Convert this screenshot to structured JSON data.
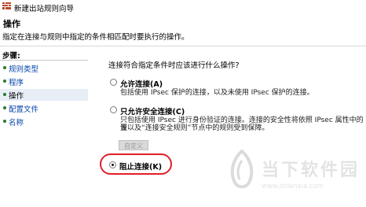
{
  "window": {
    "title": "新建出站规则向导"
  },
  "header": {
    "title": "操作",
    "description": "指定在连接与规则中指定的条件相匹配时要执行的操作。"
  },
  "sidebar": {
    "steps_label": "步骤:",
    "items": [
      {
        "label": "规则类型"
      },
      {
        "label": "程序"
      },
      {
        "label": "操作"
      },
      {
        "label": "配置文件"
      },
      {
        "label": "名称"
      }
    ]
  },
  "main": {
    "question": "连接符合指定条件时应该进行什么操作?",
    "options": [
      {
        "label": "允许连接(A)",
        "desc_lines": [
          "包括使用 IPsec 保护的连接，以及未使用 IPsec 保护的连接。"
        ]
      },
      {
        "label": "只允许安全连接(C)",
        "desc_lines": [
          "只包括使用 IPsec 进行身份验证的连接。连接的安全性将依照 IPsec 属性中的设",
          "置以及“连接安全规则”节点中的规则受到保障。"
        ]
      },
      {
        "label": "阻止连接(K)",
        "desc_lines": []
      }
    ],
    "customize_label": "自定义",
    "selected_option": 2
  },
  "watermark": {
    "text": "当下软件园",
    "url": "www.downxia.com"
  },
  "colors": {
    "highlight": "#e0202a",
    "link": "#0645a8",
    "bullet": "#2a7a2a"
  }
}
